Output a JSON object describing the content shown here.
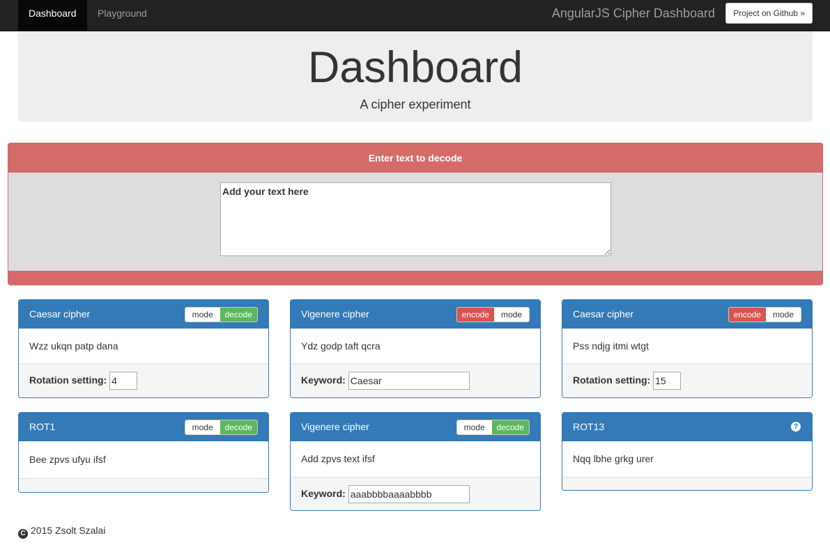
{
  "nav": {
    "tabs": [
      {
        "label": "Dashboard",
        "active": true
      },
      {
        "label": "Playground",
        "active": false
      }
    ],
    "brand": "AngularJS Cipher Dashboard",
    "github_button": "Project on Github »"
  },
  "jumbotron": {
    "title": "Dashboard",
    "subtitle": "A cipher experiment"
  },
  "input_panel": {
    "heading": "Enter text to decode",
    "placeholder": "Add your text here"
  },
  "panels": [
    {
      "title": "Caesar cipher",
      "toggle": [
        "mode",
        "decode"
      ],
      "output": "Wzz ukqn patp dana",
      "field_label": "Rotation setting:",
      "field_value": "4"
    },
    {
      "title": "Vigenere cipher",
      "toggle": [
        "encode",
        "mode"
      ],
      "output": "Ydz godp taft qcra",
      "field_label": "Keyword:",
      "field_value": "Caesar"
    },
    {
      "title": "Caesar cipher",
      "toggle": [
        "encode",
        "mode"
      ],
      "output": "Pss ndjg itmi wtgt",
      "field_label": "Rotation setting:",
      "field_value": "15"
    },
    {
      "title": "ROT1",
      "toggle": [
        "mode",
        "decode"
      ],
      "output": "Bee zpvs ufyu ifsf"
    },
    {
      "title": "Vigenere cipher",
      "toggle": [
        "mode",
        "decode"
      ],
      "output": "Add zpvs text ifsf",
      "field_label": "Keyword:",
      "field_value": "aaabbbbaaaabbbb"
    },
    {
      "title": "ROT13",
      "help_icon": "question-circle-icon",
      "output": "Nqq lbhe grkg urer"
    }
  ],
  "footer": {
    "copyright_symbol": "C",
    "text": "2015 Zsolt Szalai"
  },
  "colors": {
    "navbar": "#222222",
    "panel_primary": "#337ab7",
    "danger": "#d9534f",
    "success": "#5cb85c",
    "jumbotron": "#eeeeee"
  }
}
